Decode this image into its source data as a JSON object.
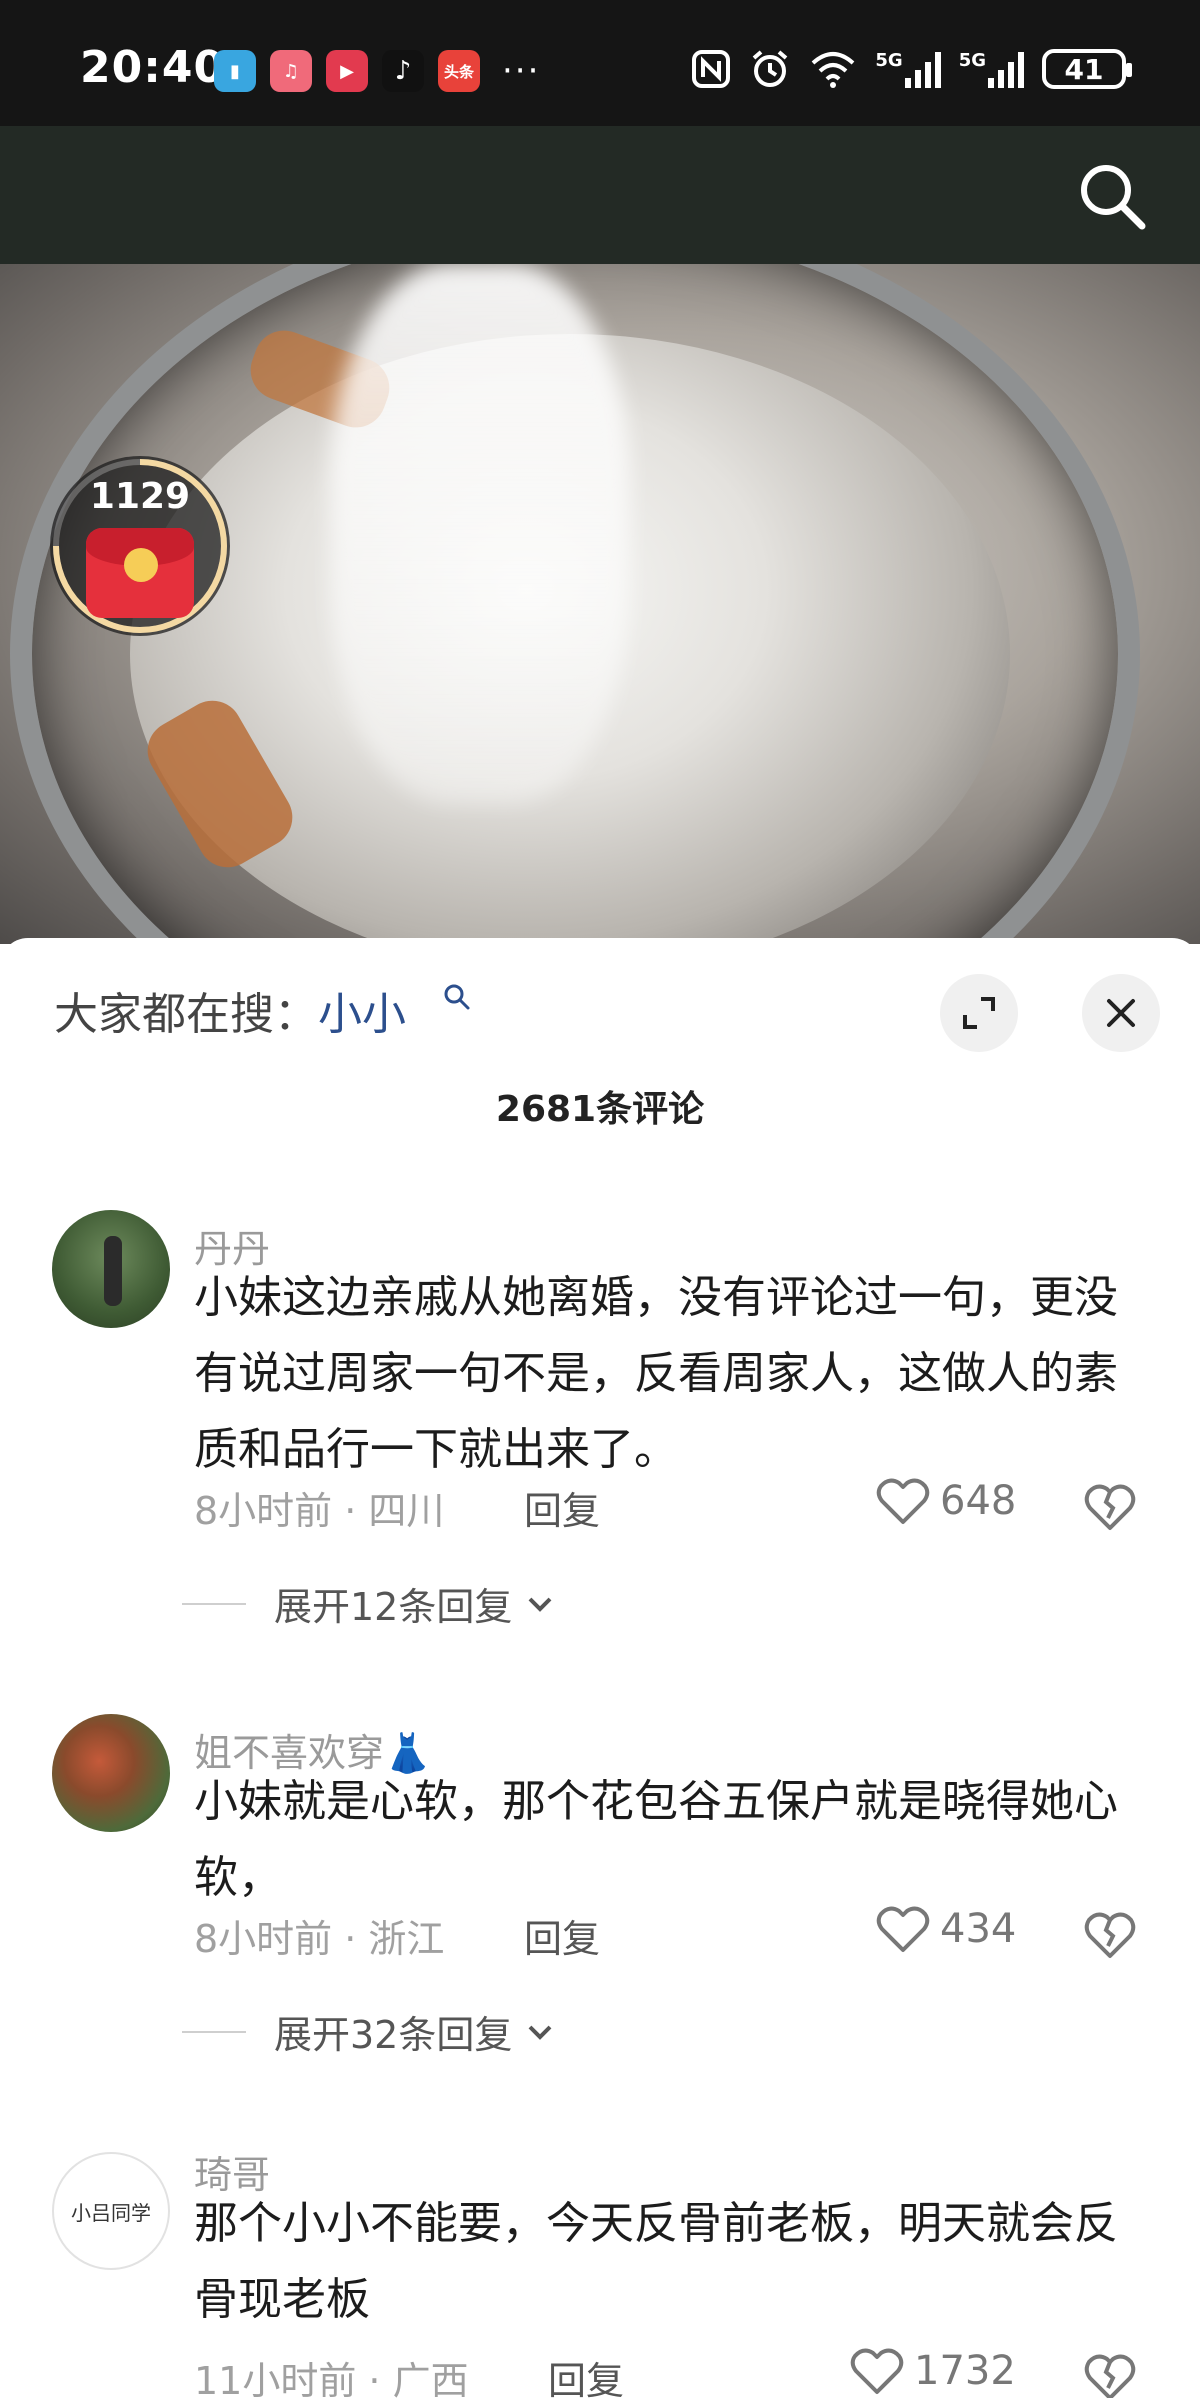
{
  "status_bar": {
    "time": "20:40",
    "app_icons": [
      {
        "name": "reader-app-icon",
        "color": "#39a6e0",
        "glyph": "▮"
      },
      {
        "name": "music-app-icon",
        "color": "#f06a7a",
        "glyph": "♫"
      },
      {
        "name": "video-app-icon",
        "color": "#e23a4f",
        "glyph": "▶"
      },
      {
        "name": "tiktok-app-icon",
        "color": "#111111",
        "glyph": "♪"
      },
      {
        "name": "toutiao-app-icon",
        "color": "#e8423a",
        "glyph": "头条"
      }
    ],
    "more": "···",
    "network_1": "5G",
    "network_2": "5G",
    "battery": "41"
  },
  "header": {
    "search_icon": "search-icon"
  },
  "video": {
    "reward_count": "1129"
  },
  "sheet": {
    "hot_search_label": "大家都在搜：",
    "hot_search_term": "小小",
    "comment_count": "2681条评论",
    "reply_label": "回复"
  },
  "comments": [
    {
      "username": "丹丹",
      "text": "小妹这边亲戚从她离婚，没有评论过一句，更没有说过周家一句不是，反看周家人，这做人的素质和品行一下就出来了。",
      "time_location": "8小时前 · 四川",
      "likes": "648",
      "expand": "展开12条回复"
    },
    {
      "username": "姐不喜欢穿👗",
      "text": "小妹就是心软，那个花包谷五保户就是晓得她心软，",
      "time_location": "8小时前 · 浙江",
      "likes": "434",
      "expand": "展开32条回复"
    },
    {
      "username": "琦哥",
      "avatar_text": "小吕同学",
      "text": "那个小小不能要，今天反骨前老板，明天就会反骨现老板",
      "time_location": "11小时前 · 广西",
      "likes": "1732"
    }
  ]
}
